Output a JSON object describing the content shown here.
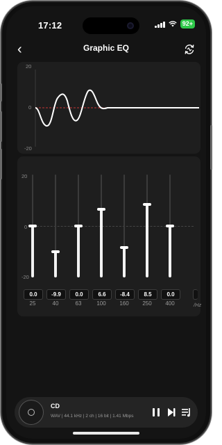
{
  "status_bar": {
    "time": "17:12",
    "battery": "92+"
  },
  "header": {
    "title": "Graphic EQ",
    "back_icon": "chevron-left-icon",
    "reset_icon": "reset-icon"
  },
  "curve": {
    "y_max_label": "20",
    "y_zero_label": "0",
    "y_min_label": "-20",
    "baseline_color": "#ff4040"
  },
  "sliders": {
    "y_max_label": "20",
    "y_zero_label": "0",
    "y_min_label": "-20",
    "range": [
      -20,
      20
    ],
    "unit_label": "/Hz",
    "bands": [
      {
        "freq": "25",
        "value": "0.0",
        "gain": 0.0
      },
      {
        "freq": "40",
        "value": "-9.9",
        "gain": -9.9
      },
      {
        "freq": "63",
        "value": "0.0",
        "gain": 0.0
      },
      {
        "freq": "100",
        "value": "6.6",
        "gain": 6.6
      },
      {
        "freq": "160",
        "value": "-8.4",
        "gain": -8.4
      },
      {
        "freq": "250",
        "value": "8.5",
        "gain": 8.5
      },
      {
        "freq": "400",
        "value": "0.0",
        "gain": 0.0
      }
    ]
  },
  "player": {
    "title": "CD",
    "info": "WAV | 44.1 kHz | 2 ch | 16 bit | 1.41 Mbps"
  }
}
